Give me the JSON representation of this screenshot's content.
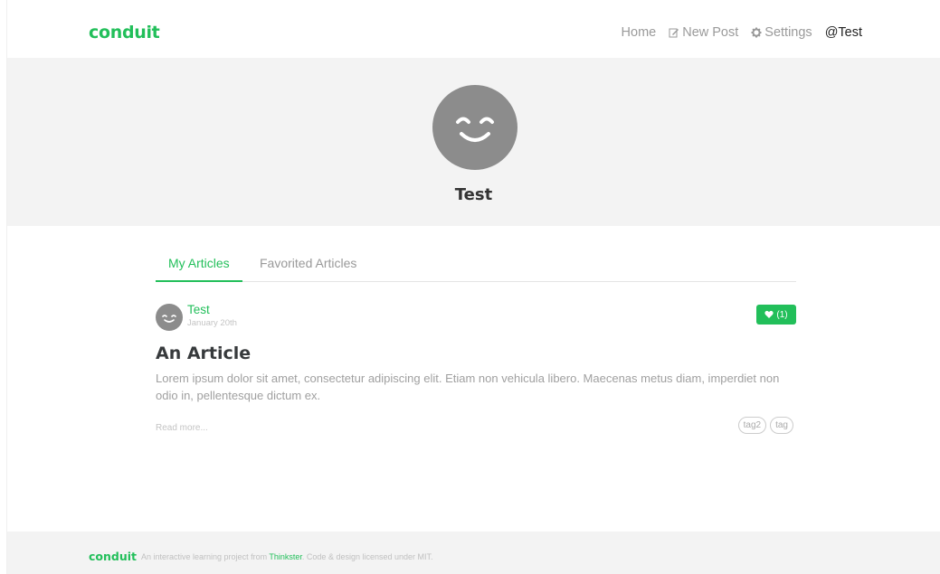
{
  "navbar": {
    "brand": "conduit",
    "links": [
      {
        "label": "Home",
        "icon": "none"
      },
      {
        "label": "New Post",
        "icon": "edit-icon"
      },
      {
        "label": "Settings",
        "icon": "gear-icon"
      },
      {
        "label": "@Test",
        "icon": "none"
      }
    ]
  },
  "profile": {
    "username": "Test",
    "avatar_icon": "smiley-avatar"
  },
  "tabs": [
    {
      "label": "My Articles",
      "active": true
    },
    {
      "label": "Favorited Articles",
      "active": false
    }
  ],
  "article": {
    "author": "Test",
    "date": "January 20th",
    "favorites_label": "(1)",
    "title": "An Article",
    "description": "Lorem ipsum dolor sit amet, consectetur adipiscing elit. Etiam non vehicula libero. Maecenas metus diam, imperdiet non odio in, pellentesque dictum ex.",
    "read_more": "Read more...",
    "tags": [
      "tag2",
      "tag"
    ]
  },
  "footer": {
    "brand": "conduit",
    "text_before": "An interactive learning project from ",
    "link": "Thinkster",
    "text_after": ". Code & design licensed under MIT."
  },
  "colors": {
    "accent": "#22bf5a",
    "banner_bg": "#f3f3f3",
    "avatar_bg": "#8c8c8c"
  }
}
